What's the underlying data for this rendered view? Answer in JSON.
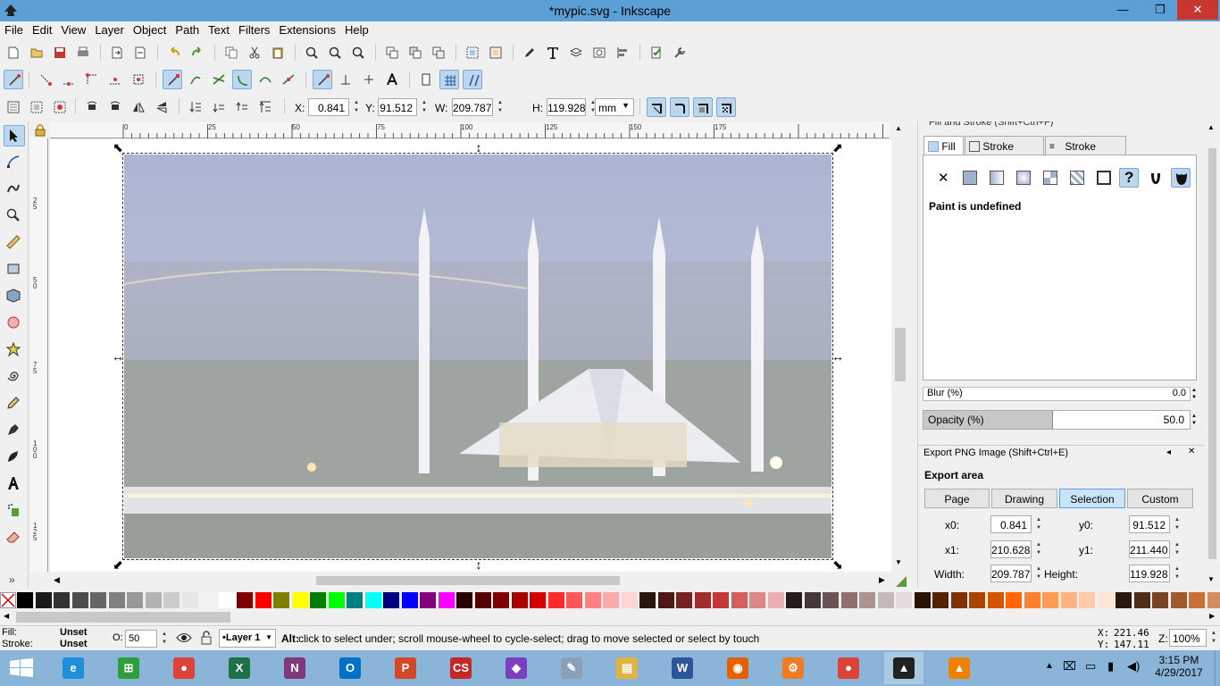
{
  "window": {
    "title": "*mypic.svg - Inkscape",
    "minimize": "—",
    "maximize": "❐",
    "close": "✕"
  },
  "menu": [
    "File",
    "Edit",
    "View",
    "Layer",
    "Object",
    "Path",
    "Text",
    "Filters",
    "Extensions",
    "Help"
  ],
  "transform": {
    "x_label": "X:",
    "x_value": "0.841",
    "y_label": "Y:",
    "y_value": "91.512",
    "w_label": "W:",
    "w_value": "209.787",
    "h_label": "H:",
    "h_value": "119.928",
    "unit": "mm"
  },
  "ruler": {
    "h_ticks": [
      "0",
      "25",
      "50",
      "75",
      "100",
      "125",
      "150",
      "175"
    ],
    "v_ticks": [
      "2 5",
      "5 0",
      "7 5",
      "1 0 0",
      "1 2 5",
      "1 5 0"
    ]
  },
  "fill_stroke": {
    "header": "Fill and Stroke (Shift+Ctrl+F)",
    "tabs": [
      "Fill",
      "Stroke paint",
      "Stroke style"
    ],
    "paint_status": "Paint is undefined",
    "blur_label": "Blur (%)",
    "blur_value": "0.0",
    "opacity_label": "Opacity (%)",
    "opacity_value": "50.0",
    "opacity_fraction": 0.5
  },
  "export": {
    "header": "Export PNG Image (Shift+Ctrl+E)",
    "area_label": "Export area",
    "buttons": [
      "Page",
      "Drawing",
      "Selection",
      "Custom"
    ],
    "active_button": "Selection",
    "x0_label": "x0:",
    "x0_value": "0.841",
    "y0_label": "y0:",
    "y0_value": "91.512",
    "x1_label": "x1:",
    "x1_value": "210.628",
    "y1_label": "y1:",
    "y1_value": "211.440",
    "width_label": "Width:",
    "width_value": "209.787",
    "height_label": "Height:",
    "height_value": "119.928"
  },
  "palette_colors": [
    "#000000",
    "#1a1a1a",
    "#333333",
    "#4d4d4d",
    "#666666",
    "#808080",
    "#999999",
    "#b3b3b3",
    "#cccccc",
    "#e6e6e6",
    "#f2f2f2",
    "#ffffff",
    "#800000",
    "#ff0000",
    "#808000",
    "#ffff00",
    "#008000",
    "#00ff00",
    "#008080",
    "#00ffff",
    "#000080",
    "#0000ff",
    "#800080",
    "#ff00ff",
    "#2b0000",
    "#550000",
    "#800000",
    "#aa0000",
    "#d40000",
    "#ff2a2a",
    "#ff5555",
    "#ff8080",
    "#ffaaaa",
    "#ffd5d5",
    "#28170b",
    "#501616",
    "#782121",
    "#a02c2c",
    "#c83737",
    "#d35f5f",
    "#de8787",
    "#e9afaf",
    "#241c1c",
    "#483737",
    "#6c5353",
    "#916f6f",
    "#ac9393",
    "#c8b7b7",
    "#e3dbdb",
    "#2b1100",
    "#552200",
    "#803300",
    "#aa4400",
    "#d45500",
    "#ff6600",
    "#ff7f2a",
    "#ff9955",
    "#ffb380",
    "#ffccaa",
    "#ffe6d5",
    "#28170b",
    "#502d16",
    "#784421",
    "#a05a2c",
    "#c87137",
    "#d38d5f"
  ],
  "status": {
    "fill_label": "Fill:",
    "fill_value": "Unset",
    "stroke_label": "Stroke:",
    "stroke_value": "Unset",
    "opacity_label": "O:",
    "opacity_value": "50",
    "layer": "•Layer 1",
    "message_bold": "Alt:",
    "message": " click to select under; scroll mouse-wheel to cycle-select; drag to move selected or select by touch",
    "cursor_x_label": "X:",
    "cursor_x": "221.46",
    "cursor_y_label": "Y:",
    "cursor_y": "147.11",
    "zoom_label": "Z:",
    "zoom": "100%"
  },
  "taskbar": {
    "time": "3:15 PM",
    "date": "4/29/2017",
    "apps": [
      {
        "name": "ie",
        "glyph": "e",
        "color": "#1d8fdb"
      },
      {
        "name": "store",
        "glyph": "⊞",
        "color": "#2f9d3b"
      },
      {
        "name": "chrome",
        "glyph": "●",
        "color": "#db4437"
      },
      {
        "name": "excel",
        "glyph": "X",
        "color": "#1e7145"
      },
      {
        "name": "onenote",
        "glyph": "N",
        "color": "#80397b"
      },
      {
        "name": "outlook",
        "glyph": "O",
        "color": "#0072c6"
      },
      {
        "name": "powerpoint",
        "glyph": "P",
        "color": "#d24726"
      },
      {
        "name": "cs-eagle",
        "glyph": "CS",
        "color": "#c62828"
      },
      {
        "name": "app-purple",
        "glyph": "◆",
        "color": "#7b3fbf"
      },
      {
        "name": "paint",
        "glyph": "✎",
        "color": "#8aa0b8"
      },
      {
        "name": "explorer",
        "glyph": "▤",
        "color": "#e3b341"
      },
      {
        "name": "word",
        "glyph": "W",
        "color": "#2b579a"
      },
      {
        "name": "firefox",
        "glyph": "◉",
        "color": "#e66000"
      },
      {
        "name": "app-orange",
        "glyph": "⚙",
        "color": "#f07b24"
      },
      {
        "name": "chrome2",
        "glyph": "●",
        "color": "#db4437"
      },
      {
        "name": "inkscape",
        "glyph": "▲",
        "color": "#222222"
      },
      {
        "name": "vlc",
        "glyph": "▲",
        "color": "#f08000"
      }
    ]
  }
}
